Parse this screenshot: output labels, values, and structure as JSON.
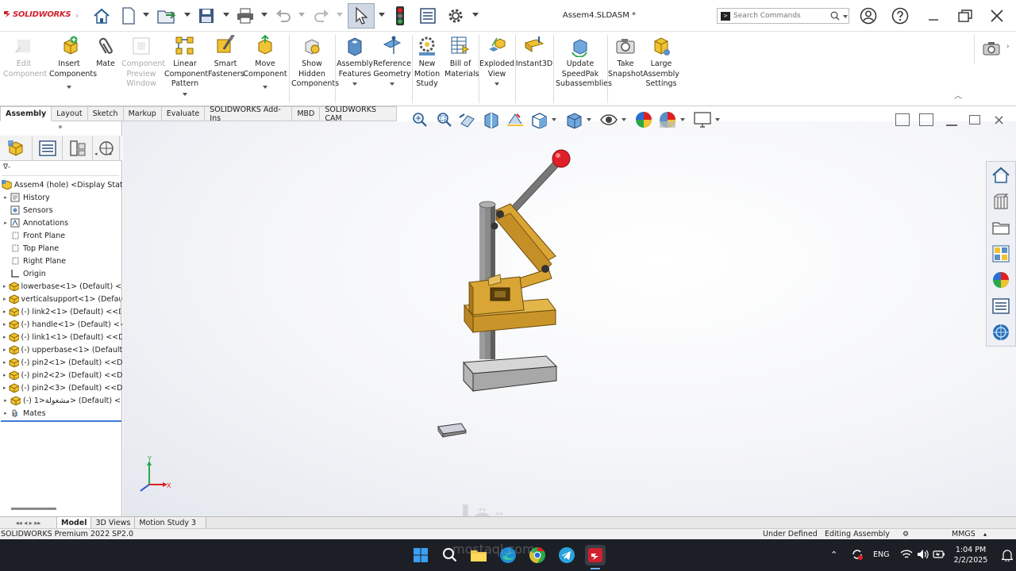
{
  "app": {
    "logo": "SOLIDWORKS",
    "doc_title": "Assem4.SLDASM *"
  },
  "search": {
    "placeholder": "Search Commands"
  },
  "ribbon": {
    "buttons": [
      {
        "id": "edit-component",
        "label": "Edit Component",
        "disabled": true
      },
      {
        "id": "insert-components",
        "label": "Insert Components"
      },
      {
        "id": "mate",
        "label": "Mate"
      },
      {
        "id": "component-preview-window",
        "label": "Component Preview Window",
        "disabled": true
      },
      {
        "id": "linear-component-pattern",
        "label": "Linear Component Pattern"
      },
      {
        "id": "smart-fasteners",
        "label": "Smart Fasteners"
      },
      {
        "id": "move-component",
        "label": "Move Component"
      },
      {
        "id": "show-hidden-components",
        "label": "Show Hidden Components"
      },
      {
        "id": "assembly-features",
        "label": "Assembly Features"
      },
      {
        "id": "reference-geometry",
        "label": "Reference Geometry"
      },
      {
        "id": "new-motion-study",
        "label": "New Motion Study"
      },
      {
        "id": "bill-of-materials",
        "label": "Bill of Materials"
      },
      {
        "id": "exploded-view",
        "label": "Exploded View"
      },
      {
        "id": "instant3d",
        "label": "Instant3D"
      },
      {
        "id": "update-speedpak",
        "label": "Update SpeedPak Subassemblies"
      },
      {
        "id": "take-snapshot",
        "label": "Take Snapshot"
      },
      {
        "id": "large-assembly-settings",
        "label": "Large Assembly Settings"
      }
    ]
  },
  "tabs": [
    "Assembly",
    "Layout",
    "Sketch",
    "Markup",
    "Evaluate",
    "SOLIDWORKS Add-Ins",
    "MBD",
    "SOLIDWORKS CAM"
  ],
  "tree": {
    "filter": "∇-",
    "root": "Assem4 (hole) <Display State-",
    "items": [
      {
        "label": "History",
        "icon": "history-icon",
        "expand": true
      },
      {
        "label": "Sensors",
        "icon": "sensors-icon",
        "expand": false
      },
      {
        "label": "Annotations",
        "icon": "annotations-icon",
        "expand": true
      },
      {
        "label": "Front Plane",
        "icon": "plane-icon",
        "expand": false
      },
      {
        "label": "Top Plane",
        "icon": "plane-icon",
        "expand": false
      },
      {
        "label": "Right Plane",
        "icon": "plane-icon",
        "expand": false
      },
      {
        "label": "Origin",
        "icon": "origin-icon",
        "expand": false
      },
      {
        "label": "lowerbase<1> (Default) <<",
        "icon": "part-icon",
        "expand": true
      },
      {
        "label": "verticalsupport<1> (Defaul",
        "icon": "part-icon",
        "expand": true
      },
      {
        "label": "(-) link2<1> (Default) <<D",
        "icon": "part-icon",
        "expand": true
      },
      {
        "label": "(-) handle<1> (Default) <<",
        "icon": "part-icon",
        "expand": true
      },
      {
        "label": "(-) link1<1> (Default) <<D",
        "icon": "part-icon",
        "expand": true
      },
      {
        "label": "(-) upperbase<1> (Default)",
        "icon": "part-icon",
        "expand": true
      },
      {
        "label": "(-) pin2<1> (Default) <<De",
        "icon": "part-icon",
        "expand": true
      },
      {
        "label": "(-) pin2<2> (Default) <<De",
        "icon": "part-icon",
        "expand": true
      },
      {
        "label": "(-) pin2<3> (Default) <<De",
        "icon": "part-icon",
        "expand": true
      },
      {
        "label": "(-) مشغولة<1> (Default) <",
        "icon": "part-icon",
        "expand": true
      },
      {
        "label": "Mates",
        "icon": "mates-icon",
        "expand": true
      }
    ]
  },
  "bottom_tabs": [
    "Model",
    "3D Views",
    "Motion Study 3"
  ],
  "status": {
    "left": "SOLIDWORKS Premium 2022 SP2.0",
    "state": "Under Defined",
    "mode": "Editing Assembly",
    "units": "MMGS"
  },
  "taskbar": {
    "lang": "ENG",
    "time": "1:04 PM",
    "date": "2/2/2025"
  },
  "triad": {
    "x": "X",
    "y": "Y"
  },
  "watermark": {
    "text": "مستقل",
    "sub": "mostaql.com"
  },
  "colors": {
    "accent": "#3d7bd6",
    "part": "#d9a534",
    "part_dark": "#a9781d",
    "metal": "#7a7a7a",
    "base": "#c8c8c8",
    "knob": "#e0202a"
  }
}
